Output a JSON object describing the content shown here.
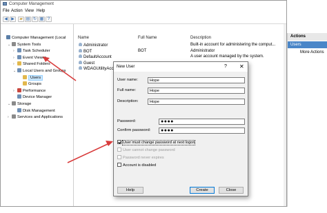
{
  "window": {
    "title": "Computer Management"
  },
  "menu": [
    "File",
    "Action",
    "View",
    "Help"
  ],
  "tree": [
    {
      "label": "Computer Management (Local",
      "indent": 0,
      "expander": "",
      "color": "#5b7fa8"
    },
    {
      "label": "System Tools",
      "indent": 1,
      "expander": "v",
      "color": "#8a8a8a"
    },
    {
      "label": "Task Scheduler",
      "indent": 2,
      "expander": ">",
      "color": "#6f8fb5"
    },
    {
      "label": "Event Viewer",
      "indent": 2,
      "expander": ">",
      "color": "#6f8fb5"
    },
    {
      "label": "Shared Folders",
      "indent": 2,
      "expander": ">",
      "color": "#e2b84d"
    },
    {
      "label": "Local Users and Groups",
      "indent": 2,
      "expander": "v",
      "color": "#6f8fb5"
    },
    {
      "label": "Users",
      "indent": 3,
      "expander": "",
      "color": "#e2b84d",
      "selected": true
    },
    {
      "label": "Groups",
      "indent": 3,
      "expander": "",
      "color": "#e2b84d"
    },
    {
      "label": "Performance",
      "indent": 2,
      "expander": ">",
      "color": "#c9473f"
    },
    {
      "label": "Device Manager",
      "indent": 2,
      "expander": "",
      "color": "#6f8fb5"
    },
    {
      "label": "Storage",
      "indent": 1,
      "expander": "v",
      "color": "#8a8a8a"
    },
    {
      "label": "Disk Management",
      "indent": 2,
      "expander": "",
      "color": "#6f8fb5"
    },
    {
      "label": "Services and Applications",
      "indent": 1,
      "expander": ">",
      "color": "#8a8a8a"
    }
  ],
  "list": {
    "headers": [
      "Name",
      "Full Name",
      "Description"
    ],
    "rows": [
      {
        "name": "Administrator",
        "full": "",
        "desc": "Built-in account for administering the comput..."
      },
      {
        "name": "BOT",
        "full": "BOT",
        "desc": "Administrator"
      },
      {
        "name": "DefaultAccount",
        "full": "",
        "desc": "A user account managed by the system."
      },
      {
        "name": "Guest",
        "full": "",
        "desc": ""
      },
      {
        "name": "WDAGUtilityAcc",
        "full": "",
        "desc": ""
      }
    ]
  },
  "actions": {
    "header": "Actions",
    "selected": "Users",
    "more": "More Actions"
  },
  "dialog": {
    "title": "New User",
    "help_glyph": "?",
    "close_glyph": "✕",
    "fields": {
      "user_name": {
        "label": "User name:",
        "value": "Hope"
      },
      "full_name": {
        "label": "Full name:",
        "value": "Hope"
      },
      "description": {
        "label": "Description:",
        "value": "Hope"
      },
      "password": {
        "label": "Password:",
        "value": "●●●●"
      },
      "confirm": {
        "label": "Confirm password:",
        "value": "●●●●"
      }
    },
    "checkboxes": [
      {
        "label": "User must change password at next logon",
        "checked": true,
        "disabled": false
      },
      {
        "label": "User cannot change password",
        "checked": false,
        "disabled": true
      },
      {
        "label": "Password never expires",
        "checked": false,
        "disabled": true
      },
      {
        "label": "Account is disabled",
        "checked": false,
        "disabled": false
      }
    ],
    "buttons": {
      "help": "Help",
      "create": "Create",
      "close": "Close"
    }
  },
  "colors": {
    "accent": "#4a86c8",
    "arrow": "#d83b3b",
    "selection": "#cce8ff"
  }
}
